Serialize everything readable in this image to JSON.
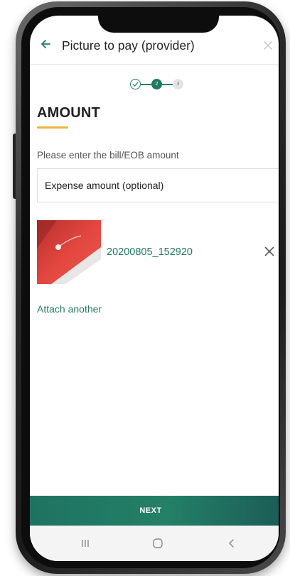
{
  "header": {
    "title": "Picture to pay (provider)",
    "back_icon": "arrow-left-icon",
    "close_icon": "close-icon"
  },
  "stepper": {
    "steps": [
      {
        "label": "",
        "state": "completed"
      },
      {
        "label": "2",
        "state": "active"
      },
      {
        "label": "3",
        "state": "upcoming"
      }
    ]
  },
  "section": {
    "title": "AMOUNT",
    "instruction": "Please enter the bill/EOB amount"
  },
  "amount_input": {
    "placeholder": "Expense amount (optional)",
    "value": ""
  },
  "attachment": {
    "file_name": "20200805_152920",
    "remove_icon": "close-icon"
  },
  "attach_another_label": "Attach another",
  "footer": {
    "next_label": "NEXT"
  },
  "system_nav": {
    "recents_icon": "recents-icon",
    "home_icon": "home-icon",
    "back_icon": "chevron-left-icon"
  },
  "colors": {
    "accent_green": "#237a63",
    "underline_yellow": "#f2b43a",
    "button_green": "#1e7360"
  }
}
